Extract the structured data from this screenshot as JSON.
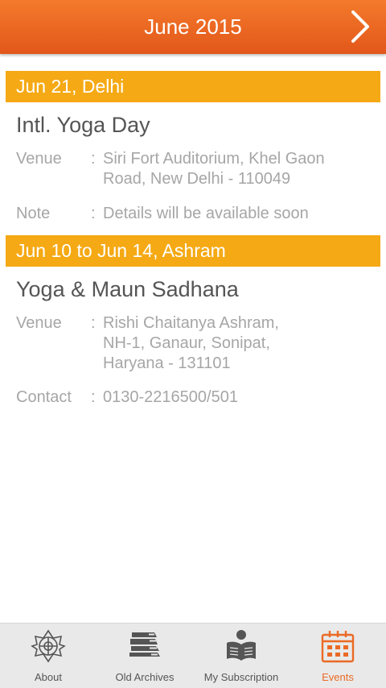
{
  "header": {
    "title": "June 2015",
    "next_icon": "chevron-right-icon"
  },
  "events": [
    {
      "band": "Jun 21, Delhi",
      "title": "Intl. Yoga Day",
      "rows": [
        {
          "label": "Venue",
          "colon": ":",
          "value": "Siri Fort Auditorium, Khel Gaon\nRoad, New Delhi - 110049"
        },
        {
          "label": "Note",
          "colon": ":",
          "value": "Details will be available soon"
        }
      ]
    },
    {
      "band": "Jun 10 to Jun 14, Ashram",
      "title": "Yoga & Maun Sadhana",
      "rows": [
        {
          "label": "Venue",
          "colon": ":",
          "value": "Rishi Chaitanya Ashram,\nNH-1, Ganaur, Sonipat,\nHaryana - 131101"
        },
        {
          "label": "Contact",
          "colon": ":",
          "value": "0130-2216500/501"
        }
      ]
    }
  ],
  "tabs": [
    {
      "label": "About",
      "icon": "mandala-icon",
      "active": false
    },
    {
      "label": "Old Archives",
      "icon": "books-icon",
      "active": false
    },
    {
      "label": "My Subscription",
      "icon": "reader-icon",
      "active": false
    },
    {
      "label": "Events",
      "icon": "calendar-icon",
      "active": true
    }
  ],
  "colors": {
    "header": "#e8621f",
    "band": "#f5a914",
    "active_tab": "#ea6a25"
  }
}
